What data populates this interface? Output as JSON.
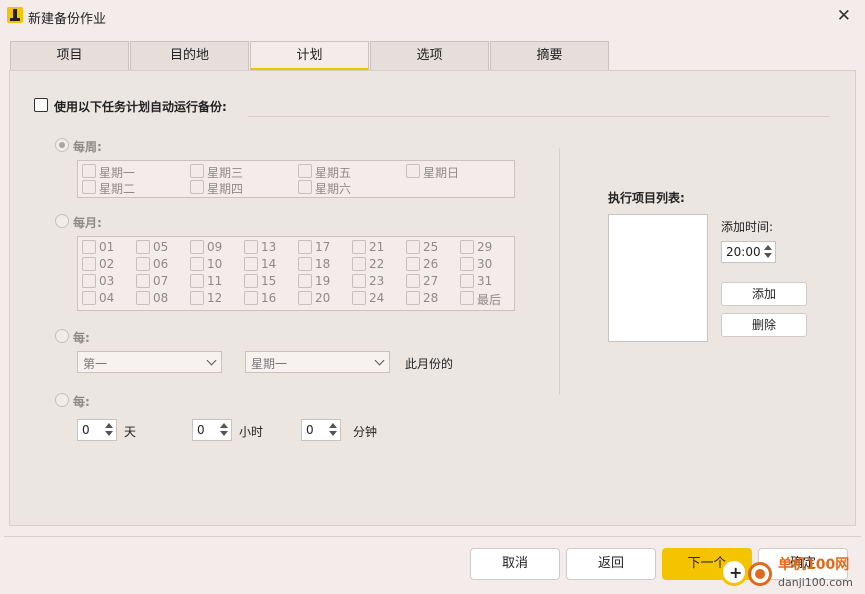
{
  "window": {
    "title": "新建备份作业",
    "close_icon": "close-icon"
  },
  "tabs": [
    {
      "label": "项目"
    },
    {
      "label": "目的地"
    },
    {
      "label": "计划",
      "active": true
    },
    {
      "label": "选项"
    },
    {
      "label": "摘要"
    }
  ],
  "schedule": {
    "enable_label": "使用以下任务计划自动运行备份:",
    "enabled": false,
    "weekly": {
      "label": "每周:",
      "selected": true,
      "days": [
        "星期一",
        "星期三",
        "星期五",
        "星期日",
        "星期二",
        "星期四",
        "星期六"
      ]
    },
    "monthly": {
      "label": "每月:",
      "days": [
        "01",
        "05",
        "09",
        "13",
        "17",
        "21",
        "25",
        "29",
        "02",
        "06",
        "10",
        "14",
        "18",
        "22",
        "26",
        "30",
        "03",
        "07",
        "11",
        "15",
        "19",
        "23",
        "27",
        "31",
        "04",
        "08",
        "12",
        "16",
        "20",
        "24",
        "28",
        "最后"
      ]
    },
    "every_month": {
      "label": "每:",
      "ordinal_value": "第一",
      "weekday_value": "星期一",
      "suffix": "此月份的"
    },
    "every_interval": {
      "label": "每:",
      "days_value": "0",
      "days_unit": "天",
      "hours_value": "0",
      "hours_unit": "小时",
      "minutes_value": "0",
      "minutes_unit": "分钟"
    }
  },
  "execution_list": {
    "label": "执行项目列表:",
    "add_time_label": "添加时间:",
    "time_value": "20:00",
    "add_button": "添加",
    "delete_button": "删除"
  },
  "footer": {
    "cancel": "取消",
    "back": "返回",
    "next": "下一个",
    "ok": "确定"
  },
  "watermark": {
    "text1": "单机100网",
    "text2": "danji100.com"
  },
  "colors": {
    "accent": "#f5c400",
    "background": "#f3ecea",
    "panel": "#ece6e2"
  }
}
